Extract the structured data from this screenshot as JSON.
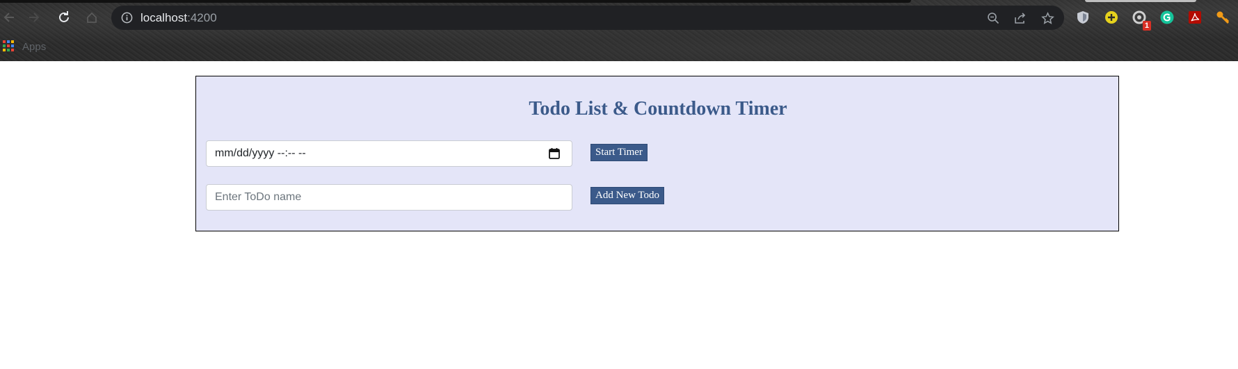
{
  "browser": {
    "url_host": "localhost",
    "url_port": ":4200",
    "bookmarks_bar": {
      "apps_label": "Apps"
    },
    "nav_icons": [
      "back-arrow-icon",
      "forward-arrow-icon",
      "reload-icon",
      "home-icon"
    ],
    "omnibox_icons": [
      "site-info-icon",
      "zoom-out-icon",
      "share-icon",
      "bookmark-star-icon"
    ],
    "extensions": [
      {
        "name": "shield-extension-icon"
      },
      {
        "name": "plus-extension-icon"
      },
      {
        "name": "grey-extension-icon",
        "badge": "1"
      },
      {
        "name": "grammarly-extension-icon"
      },
      {
        "name": "acrobat-extension-icon"
      },
      {
        "name": "key-extension-icon"
      }
    ]
  },
  "app": {
    "title": "Todo List & Countdown Timer",
    "datetime_input": {
      "value": "mm/dd/yyyy --:-- --"
    },
    "start_timer_button": "Start Timer",
    "todo_input": {
      "placeholder": "Enter ToDo name"
    },
    "add_todo_button": "Add New Todo"
  },
  "colors": {
    "panel_background": "#e4e5f8",
    "accent": "#3b5a8a",
    "omnibox": "#202124"
  }
}
